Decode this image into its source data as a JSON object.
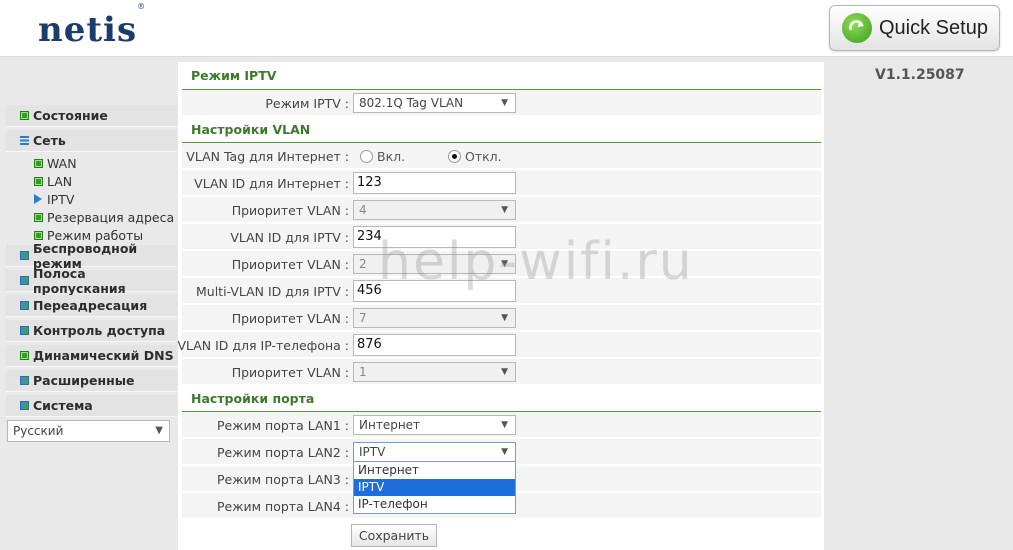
{
  "header": {
    "logo": "netis",
    "logo_mark": "®",
    "quick_setup_label": "Quick Setup"
  },
  "sidebar": {
    "items": [
      {
        "label": "Состояние",
        "icon": "status-icon"
      },
      {
        "label": "Сеть",
        "icon": "network-icon"
      },
      {
        "label": "Беспроводной режим",
        "icon": "wireless-icon"
      },
      {
        "label": "Полоса пропускания",
        "icon": "bandwidth-icon"
      },
      {
        "label": "Переадресация",
        "icon": "forwarding-icon"
      },
      {
        "label": "Контроль доступа",
        "icon": "access-control-icon"
      },
      {
        "label": "Динамический DNS",
        "icon": "ddns-icon"
      },
      {
        "label": "Расширенные",
        "icon": "advanced-icon"
      },
      {
        "label": "Система",
        "icon": "system-icon"
      }
    ],
    "network_sub": [
      {
        "label": "WAN"
      },
      {
        "label": "LAN"
      },
      {
        "label": "IPTV",
        "active": true
      },
      {
        "label": "Резервация адреса"
      },
      {
        "label": "Режим работы"
      }
    ],
    "language": "Русский"
  },
  "version": "V1.1.25087",
  "iptv": {
    "section_title": "Режим IPTV",
    "mode_label": "Режим IPTV :",
    "mode_value": "802.1Q Tag VLAN"
  },
  "vlan": {
    "section_title": "Настройки VLAN",
    "tag_label": "VLAN Tag для Интернет :",
    "tag_on": "Вкл.",
    "tag_off": "Откл.",
    "tag_selected": "off",
    "internet_id_label": "VLAN ID для Интернет :",
    "internet_id_value": "123",
    "internet_prio_label": "Приоритет VLAN :",
    "internet_prio_value": "4",
    "iptv_id_label": "VLAN ID для IPTV :",
    "iptv_id_value": "234",
    "iptv_prio_label": "Приоритет VLAN :",
    "iptv_prio_value": "2",
    "multi_id_label": "Multi-VLAN ID для IPTV :",
    "multi_id_value": "456",
    "multi_prio_label": "Приоритет VLAN :",
    "multi_prio_value": "7",
    "phone_id_label": "VLAN ID для IP-телефона :",
    "phone_id_value": "876",
    "phone_prio_label": "Приоритет VLAN :",
    "phone_prio_value": "1"
  },
  "ports": {
    "section_title": "Настройки порта",
    "lan1_label": "Режим порта LAN1 :",
    "lan1_value": "Интернет",
    "lan2_label": "Режим порта LAN2 :",
    "lan2_value": "IPTV",
    "lan3_label": "Режим порта LAN3 :",
    "lan4_label": "Режим порта LAN4 :",
    "options": [
      "Интернет",
      "IPTV",
      "IP-телефон"
    ]
  },
  "save_label": "Сохранить",
  "watermark": "help-wifi.ru",
  "colors": {
    "brand": "#1d3c6e",
    "section_title": "#3d7a2e",
    "dropdown_highlight": "#1e6fdc"
  }
}
